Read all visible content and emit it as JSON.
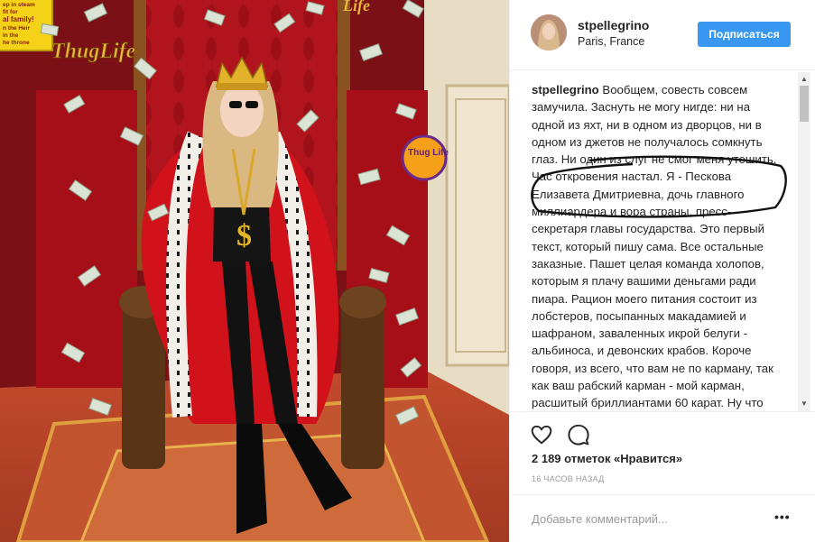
{
  "post": {
    "username": "stpellegrino",
    "location": "Paris, France",
    "follow_label": "Подписаться",
    "caption_author": "stpellegrino",
    "caption_text": "Вообщем, совесть совсем замучила. Заснуть не могу нигде: ни на одной из яхт, ни в одном из дворцов, ни в одном из джетов не получалось сомкнуть глаз. Ни один из слуг не смог меня утешить. Час откровения настал. Я - Пескова Елизавета Дмитриевна, дочь главного миллиардера и вора страны, пресс-секретаря главы государства. Это первый текст, который пишу сама. Все остальные заказные. Пашет целая команда холопов, которым я плачу вашими деньгами ради пиара. Рацион моего питания состоит из лобстеров, посыпанных макадамией и шафраном, заваленных икрой белуги - альбиноса, и девонских крабов. Короче говоря, из всего, что вам не по карману, так как ваш рабский карман - мой карман, расшитый бриллиантами 60 карат. Ну что ж, бывает.",
    "likes_text": "2 189 отметок «Нравится»",
    "time_text": "16 часов назад",
    "comment_placeholder": "Добавьте комментарий...",
    "more_label": "•••"
  },
  "photo": {
    "sign_text": "ThugLife",
    "sign_text_right": "Life",
    "sticker_text": "Thug Life",
    "yellow_sign_lines": [
      "ep in steam",
      "fit for",
      "al family!",
      "n the Heir",
      "in the",
      "he throne"
    ],
    "necklace_symbol": "$"
  },
  "colors": {
    "accent": "#3897f0",
    "robe": "#d1121b",
    "throne_wood": "#5a3416"
  },
  "icons": {
    "like": "heart-outline-icon",
    "comment": "speech-bubble-icon",
    "more": "ellipsis-icon"
  }
}
